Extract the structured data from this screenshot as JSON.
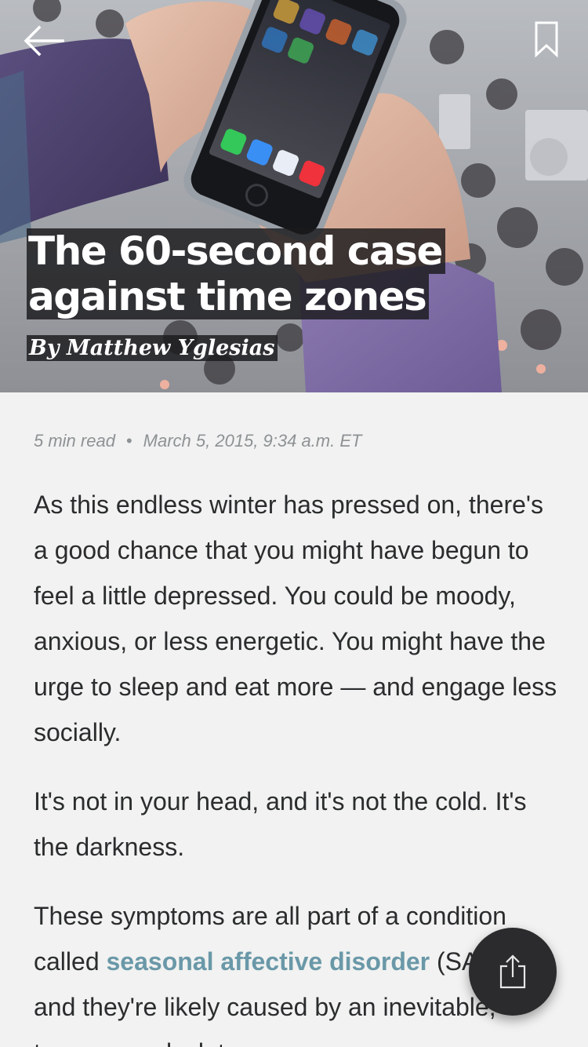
{
  "header": {
    "back_icon": "arrow-left-icon",
    "bookmark_icon": "bookmark-icon"
  },
  "hero": {
    "title_line1": "The 60-second case",
    "title_line2": "against time zones",
    "byline": "By Matthew Yglesias",
    "image_icon": "crowd-smartphone-photo"
  },
  "meta": {
    "read_time": "5 min read",
    "separator": "•",
    "date": "March 5, 2015, 9:34 a.m. ET"
  },
  "article": {
    "p1": "As this endless winter has pressed on, there's a good chance that you might have begun to feel a little depressed. You could be moody, anxious, or less energetic. You might have the urge to sleep and eat more — and engage less socially.",
    "p2": "It's not in your head, and it's not the cold. It's the darkness.",
    "p3_before": "These symptoms are all part of a condition called ",
    "p3_link": "seasonal affective disorder",
    "p3_after": " (SAD), and they're likely caused by an inevitable, temporary clock trap",
    "link_color": "#6a98a8"
  },
  "fab": {
    "share_icon": "share-icon"
  }
}
